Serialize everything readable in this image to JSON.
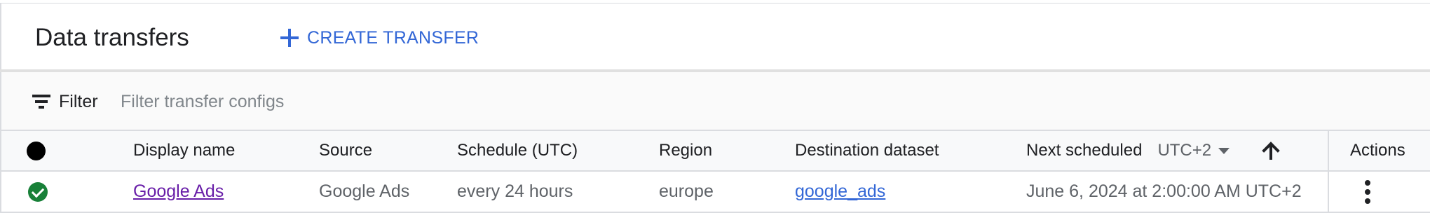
{
  "header": {
    "title": "Data transfers",
    "create_label": "CREATE TRANSFER"
  },
  "filter": {
    "label": "Filter",
    "placeholder": "Filter transfer configs",
    "value": ""
  },
  "table": {
    "columns": {
      "display_name": "Display name",
      "source": "Source",
      "schedule": "Schedule (UTC)",
      "region": "Region",
      "destination": "Destination dataset",
      "next_scheduled": "Next scheduled",
      "timezone": "UTC+2",
      "actions": "Actions"
    },
    "rows": [
      {
        "status": "success",
        "display_name": "Google Ads",
        "source": "Google Ads",
        "schedule": "every 24 hours",
        "region": "europe",
        "destination": "google_ads",
        "next_scheduled": "June 6, 2024 at 2:00:00 AM UTC+2"
      }
    ]
  },
  "colors": {
    "accent": "#3367d6",
    "visited_link": "#681da8",
    "success": "#188038",
    "border": "#dadce0"
  },
  "icons": [
    "add-icon",
    "filter-icon",
    "status-dot-icon",
    "caret-down-icon",
    "arrow-up-icon",
    "check-circle-icon",
    "more-vert-icon"
  ]
}
